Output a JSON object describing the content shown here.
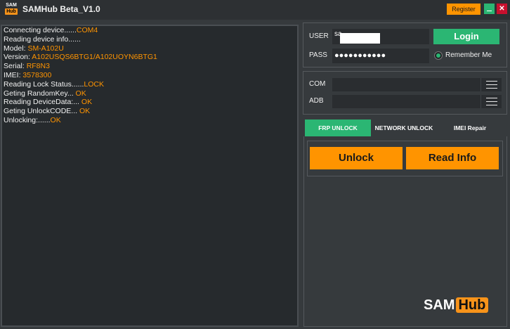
{
  "window": {
    "logo_top": "SAM",
    "logo_bottom": "Hub",
    "title": "SAMHub Beta_V1.0",
    "register_label": "Register",
    "close_glyph": "✕"
  },
  "log": [
    {
      "text": "Connecting device......",
      "value": "COM4"
    },
    {
      "text": "Reading device info......",
      "value": ""
    },
    {
      "text": "Model: ",
      "value": "SM-A102U"
    },
    {
      "text": "Version: ",
      "value": "A102USQS6BTG1/A102UOYN6BTG1"
    },
    {
      "text": "Serial: ",
      "value": "RF8N3"
    },
    {
      "text": "IMEI: ",
      "value": "3578300"
    },
    {
      "text": "Reading Lock Status......",
      "value": "LOCK"
    },
    {
      "text": "Geting RandomKey... ",
      "value": "OK"
    },
    {
      "text": "Reading DeviceData:... ",
      "value": "OK"
    },
    {
      "text": "Geting UnlockCODE... ",
      "value": "OK"
    },
    {
      "text": "Unlocking:......",
      "value": "OK"
    }
  ],
  "login": {
    "user_label": "USER",
    "user_value": "sa",
    "pass_label": "PASS",
    "pass_value": "●●●●●●●●●●●",
    "login_label": "Login",
    "remember_label": "Remember Me",
    "remember_checked": true
  },
  "ports": {
    "com_label": "COM",
    "adb_label": "ADB",
    "com_value": "",
    "adb_value": ""
  },
  "tabs": [
    {
      "label": "FRP UNLOCK",
      "active": true
    },
    {
      "label": "NETWORK UNLOCK",
      "active": false
    },
    {
      "label": "IMEI Repair",
      "active": false
    }
  ],
  "actions": {
    "unlock_label": "Unlock",
    "read_info_label": "Read Info"
  },
  "brand": {
    "part1": "SAM",
    "part2": "Hub"
  },
  "colors": {
    "accent_orange": "#ff9400",
    "accent_green": "#2bb673",
    "close_red": "#c8102e",
    "background": "#363a3d",
    "log_background": "#262a2d"
  }
}
